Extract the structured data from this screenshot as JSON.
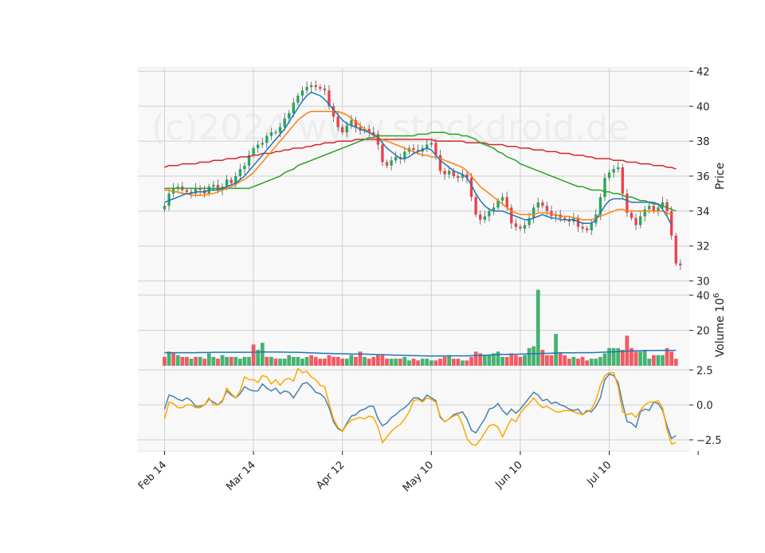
{
  "watermark": "(c)2024 www.stockdroid.de",
  "colors": {
    "background": "#f8f8f8",
    "grid": "#d0d0d0",
    "up": "#26a65b",
    "down": "#ef3f4a",
    "ma_fast": "#1f77b4",
    "ma_mid": "#ff7f0e",
    "ma_slow": "#2ca02c",
    "ma_long": "#d62728",
    "osc_a": "#4682b4",
    "osc_b": "#ffa500"
  },
  "chart_data": [
    {
      "type": "candlestick",
      "ylabel": "Price",
      "ylim": [
        29.8,
        42.2
      ],
      "yticks": [
        30,
        32,
        34,
        36,
        38,
        40,
        42
      ],
      "xlim": [
        -6,
        118
      ],
      "xticks": [
        {
          "x": 0,
          "label": "Feb 14"
        },
        {
          "x": 20,
          "label": "Mar 14"
        },
        {
          "x": 40,
          "label": "Apr 12"
        },
        {
          "x": 60,
          "label": "May 10"
        },
        {
          "x": 80,
          "label": "Jun 10"
        },
        {
          "x": 100,
          "label": "Jul 10"
        },
        {
          "x": 120,
          "label": ""
        }
      ],
      "y_axis_position": "right",
      "grid": true,
      "close": [
        34.3,
        35.0,
        35.3,
        35.4,
        35.2,
        35.1,
        35.0,
        35.3,
        35.2,
        35.0,
        35.4,
        35.5,
        35.2,
        35.4,
        35.8,
        35.6,
        36.0,
        36.4,
        36.6,
        37.2,
        37.6,
        37.8,
        37.9,
        38.3,
        38.5,
        38.5,
        38.8,
        39.3,
        39.6,
        40.2,
        40.6,
        40.9,
        41.1,
        41.2,
        41.1,
        41.0,
        40.9,
        40.0,
        39.4,
        38.8,
        38.5,
        38.9,
        39.2,
        38.8,
        38.6,
        38.7,
        38.5,
        38.4,
        37.8,
        36.8,
        36.6,
        36.9,
        37.1,
        37.0,
        37.4,
        37.6,
        37.5,
        37.4,
        37.6,
        37.8,
        37.9,
        37.2,
        36.3,
        36.1,
        36.3,
        36.0,
        35.9,
        36.1,
        35.9,
        34.8,
        33.8,
        33.5,
        33.7,
        34.0,
        34.2,
        34.6,
        34.8,
        34.2,
        33.3,
        33.1,
        33.0,
        33.2,
        33.6,
        34.2,
        34.5,
        34.3,
        34.0,
        33.7,
        33.8,
        33.6,
        33.5,
        33.4,
        33.6,
        33.1,
        33.0,
        32.9,
        33.3,
        33.8,
        34.8,
        35.9,
        36.2,
        36.4,
        36.5,
        35.0,
        33.9,
        33.6,
        33.2,
        33.7,
        34.1,
        34.3,
        34.0,
        34.2,
        34.5,
        34.0,
        32.6,
        31.0,
        30.9
      ],
      "ma_fast": [
        34.5,
        34.6,
        34.7,
        34.8,
        34.9,
        35.0,
        35.0,
        35.1,
        35.1,
        35.1,
        35.2,
        35.2,
        35.2,
        35.3,
        35.4,
        35.5,
        35.6,
        35.8,
        36.0,
        36.3,
        36.6,
        36.9,
        37.2,
        37.5,
        37.8,
        38.1,
        38.4,
        38.7,
        39.1,
        39.5,
        39.9,
        40.3,
        40.6,
        40.8,
        40.7,
        40.6,
        40.4,
        40.1,
        39.8,
        39.5,
        39.2,
        39.0,
        38.9,
        38.8,
        38.7,
        38.6,
        38.5,
        38.4,
        38.2,
        37.9,
        37.6,
        37.4,
        37.2,
        37.0,
        37.0,
        37.1,
        37.3,
        37.4,
        37.5,
        37.6,
        37.5,
        37.2,
        36.9,
        36.7,
        36.5,
        36.3,
        36.2,
        36.1,
        35.9,
        35.5,
        35.0,
        34.6,
        34.3,
        34.1,
        34.0,
        34.0,
        34.0,
        33.9,
        33.8,
        33.7,
        33.6,
        33.5,
        33.5,
        33.6,
        33.7,
        33.8,
        33.7,
        33.6,
        33.6,
        33.5,
        33.5,
        33.5,
        33.5,
        33.4,
        33.3,
        33.3,
        33.3,
        33.5,
        33.9,
        34.3,
        34.6,
        34.7,
        34.7,
        34.7,
        34.6,
        34.5,
        34.5,
        34.5,
        34.5,
        34.5,
        34.5,
        34.4,
        34.1,
        33.7,
        33.2
      ],
      "ma_mid": [
        35.2,
        35.2,
        35.1,
        35.1,
        35.0,
        35.0,
        34.9,
        34.9,
        34.9,
        34.9,
        35.0,
        35.0,
        35.1,
        35.2,
        35.3,
        35.4,
        35.5,
        35.7,
        35.8,
        36.0,
        36.2,
        36.5,
        36.8,
        37.1,
        37.4,
        37.7,
        38.0,
        38.3,
        38.6,
        38.9,
        39.2,
        39.4,
        39.6,
        39.7,
        39.7,
        39.7,
        39.7,
        39.7,
        39.7,
        39.7,
        39.6,
        39.5,
        39.3,
        39.1,
        38.9,
        38.7,
        38.5,
        38.3,
        38.2,
        38.1,
        38.0,
        37.9,
        37.8,
        37.7,
        37.6,
        37.5,
        37.4,
        37.3,
        37.2,
        37.2,
        37.1,
        37.1,
        37.0,
        36.9,
        36.8,
        36.7,
        36.6,
        36.5,
        36.3,
        36.0,
        35.7,
        35.4,
        35.2,
        35.0,
        34.8,
        34.6,
        34.4,
        34.2,
        34.0,
        33.9,
        33.8,
        33.8,
        33.8,
        33.8,
        33.9,
        33.9,
        33.9,
        33.8,
        33.8,
        33.7,
        33.7,
        33.7,
        33.6,
        33.6,
        33.5,
        33.5,
        33.5,
        33.6,
        33.7,
        33.8,
        33.9,
        34.0,
        34.1,
        34.1,
        34.0,
        34.0,
        34.0,
        34.0,
        34.0,
        34.0,
        34.0,
        34.0,
        34.0,
        33.9,
        33.8
      ],
      "ma_slow": [
        35.3,
        35.3,
        35.3,
        35.3,
        35.3,
        35.3,
        35.3,
        35.3,
        35.3,
        35.3,
        35.3,
        35.3,
        35.3,
        35.3,
        35.3,
        35.3,
        35.3,
        35.3,
        35.3,
        35.3,
        35.4,
        35.5,
        35.6,
        35.7,
        35.8,
        35.9,
        36.0,
        36.2,
        36.3,
        36.4,
        36.6,
        36.7,
        36.8,
        36.9,
        37.0,
        37.1,
        37.2,
        37.3,
        37.4,
        37.5,
        37.6,
        37.7,
        37.8,
        37.9,
        38.0,
        38.1,
        38.2,
        38.2,
        38.3,
        38.3,
        38.3,
        38.3,
        38.3,
        38.3,
        38.3,
        38.3,
        38.3,
        38.4,
        38.4,
        38.4,
        38.5,
        38.5,
        38.5,
        38.5,
        38.4,
        38.4,
        38.4,
        38.3,
        38.3,
        38.2,
        38.1,
        37.9,
        37.8,
        37.7,
        37.6,
        37.4,
        37.3,
        37.1,
        37.0,
        36.9,
        36.7,
        36.6,
        36.5,
        36.4,
        36.3,
        36.2,
        36.1,
        36.0,
        35.9,
        35.8,
        35.7,
        35.6,
        35.5,
        35.4,
        35.4,
        35.3,
        35.2,
        35.2,
        35.2,
        35.1,
        35.1,
        35.0,
        35.0,
        34.9,
        34.8,
        34.8,
        34.7,
        34.6,
        34.6,
        34.5,
        34.4,
        34.4,
        34.3,
        34.2,
        34.1,
        34.0
      ],
      "ma_long": [
        36.5,
        36.6,
        36.6,
        36.6,
        36.7,
        36.7,
        36.7,
        36.7,
        36.8,
        36.8,
        36.8,
        36.9,
        36.9,
        36.9,
        37.0,
        37.0,
        37.0,
        37.1,
        37.1,
        37.1,
        37.2,
        37.2,
        37.3,
        37.3,
        37.3,
        37.4,
        37.4,
        37.5,
        37.5,
        37.6,
        37.6,
        37.6,
        37.7,
        37.7,
        37.8,
        37.8,
        37.9,
        37.9,
        37.9,
        38.0,
        38.0,
        38.0,
        38.0,
        38.1,
        38.1,
        38.1,
        38.1,
        38.1,
        38.1,
        38.1,
        38.1,
        38.1,
        38.1,
        38.1,
        38.1,
        38.1,
        38.1,
        38.1,
        38.1,
        38.1,
        38.1,
        38.0,
        38.0,
        38.0,
        38.0,
        38.0,
        38.0,
        38.0,
        37.9,
        37.9,
        37.9,
        37.9,
        37.9,
        37.8,
        37.8,
        37.8,
        37.8,
        37.7,
        37.7,
        37.7,
        37.6,
        37.6,
        37.6,
        37.5,
        37.5,
        37.5,
        37.4,
        37.4,
        37.4,
        37.3,
        37.3,
        37.3,
        37.2,
        37.2,
        37.2,
        37.1,
        37.1,
        37.0,
        37.0,
        37.0,
        37.0,
        36.9,
        36.9,
        36.9,
        36.8,
        36.8,
        36.8,
        36.7,
        36.7,
        36.7,
        36.6,
        36.6,
        36.6,
        36.5,
        36.5,
        36.4
      ]
    },
    {
      "type": "bar",
      "ylabel": "Volume $10^6$",
      "ylim": [
        0,
        46
      ],
      "yticks": [
        20,
        40
      ],
      "grid": true,
      "volume": [
        5,
        8,
        7,
        6,
        5,
        5,
        4,
        5,
        5,
        4,
        7,
        5,
        4,
        6,
        5,
        5,
        5,
        4,
        5,
        5,
        12,
        9,
        13,
        5,
        5,
        4,
        4,
        4,
        6,
        5,
        5,
        4,
        5,
        6,
        5,
        4,
        4,
        6,
        5,
        5,
        4,
        4,
        6,
        5,
        8,
        5,
        4,
        5,
        6,
        6,
        4,
        4,
        4,
        4,
        5,
        3,
        4,
        3,
        4,
        4,
        3,
        3,
        4,
        5,
        6,
        4,
        4,
        3,
        3,
        5,
        8,
        7,
        6,
        6,
        7,
        8,
        5,
        5,
        7,
        6,
        5,
        6,
        10,
        11,
        43,
        9,
        6,
        6,
        18,
        7,
        6,
        4,
        5,
        4,
        5,
        3,
        4,
        4,
        5,
        7,
        10,
        10,
        10,
        9,
        17,
        10,
        8,
        8,
        9,
        4,
        6,
        6,
        6,
        10,
        8,
        4
      ],
      "volume_up": [
        false,
        true,
        false,
        true,
        false,
        false,
        true,
        false,
        true,
        false,
        true,
        true,
        false,
        true,
        true,
        false,
        true,
        true,
        true,
        true,
        false,
        true,
        true,
        false,
        true,
        false,
        true,
        true,
        true,
        true,
        true,
        true,
        true,
        false,
        false,
        false,
        false,
        false,
        false,
        false,
        false,
        true,
        true,
        false,
        false,
        true,
        false,
        false,
        false,
        false,
        false,
        true,
        true,
        false,
        true,
        true,
        false,
        false,
        true,
        true,
        true,
        false,
        false,
        false,
        true,
        false,
        false,
        true,
        false,
        false,
        false,
        false,
        true,
        true,
        true,
        true,
        true,
        false,
        false,
        false,
        false,
        true,
        true,
        true,
        true,
        false,
        false,
        false,
        true,
        false,
        false,
        false,
        true,
        false,
        false,
        false,
        true,
        true,
        true,
        true,
        true,
        true,
        true,
        false,
        false,
        false,
        false,
        true,
        true,
        true,
        false,
        true,
        true,
        false,
        false,
        false,
        true
      ],
      "volume_ma": [
        7.4,
        7.4,
        7.4,
        7.4,
        7.4,
        7.4,
        7.4,
        7.4,
        7.5,
        7.5,
        7.5,
        7.6,
        7.6,
        7.6,
        7.6,
        7.6,
        7.6,
        7.6,
        7.6,
        7.6,
        7.6,
        7.7,
        7.8,
        7.8,
        7.8,
        7.8,
        7.7,
        7.7,
        7.6,
        7.6,
        7.6,
        7.5,
        7.4,
        7.3,
        7.2,
        7.1,
        7.0,
        7.0,
        6.9,
        6.8,
        6.8,
        6.7,
        6.6,
        6.6,
        6.6,
        6.6,
        6.5,
        6.4,
        6.3,
        6.3,
        6.2,
        6.1,
        6.0,
        6.0,
        5.9,
        5.8,
        5.7,
        5.7,
        5.6,
        5.6,
        5.5,
        5.5,
        5.5,
        5.5,
        5.6,
        5.6,
        5.6,
        5.6,
        5.6,
        5.7,
        5.8,
        5.9,
        6.0,
        6.1,
        6.2,
        6.3,
        6.4,
        6.4,
        6.5,
        6.5,
        6.6,
        6.6,
        6.7,
        6.8,
        6.9,
        7.0,
        7.0,
        7.1,
        7.2,
        7.3,
        7.3,
        7.3,
        7.3,
        7.4,
        7.4,
        7.4,
        7.4,
        7.5,
        7.6,
        7.7,
        7.8,
        7.9,
        8.0,
        8.1,
        8.3,
        8.4,
        8.5,
        8.5,
        8.6,
        8.6,
        8.6,
        8.7,
        8.7,
        8.7,
        8.7,
        8.7
      ]
    },
    {
      "type": "line",
      "ylim": [
        -3.3,
        2.8
      ],
      "yticks": [
        {
          "v": -2.5,
          "label": "−2.5"
        },
        {
          "v": 0,
          "label": "0.0"
        },
        {
          "v": 2.5,
          "label": "2.5"
        }
      ],
      "grid": true,
      "series": [
        {
          "values": [
            -0.3,
            0.7,
            0.6,
            0.4,
            0.3,
            0.5,
            0.3,
            -0.1,
            -0.1,
            0.0,
            0.4,
            0.2,
            0.0,
            0.3,
            1.0,
            0.7,
            0.5,
            0.8,
            1.3,
            1.1,
            1.0,
            1.0,
            1.5,
            1.2,
            1.0,
            1.2,
            0.8,
            1.0,
            0.9,
            0.5,
            1.0,
            1.5,
            1.6,
            1.3,
            0.9,
            0.8,
            0.5,
            -0.2,
            -1.2,
            -1.7,
            -1.9,
            -1.3,
            -0.8,
            -0.7,
            -0.4,
            -0.3,
            -0.1,
            -0.1,
            -1.0,
            -1.5,
            -1.3,
            -0.9,
            -0.7,
            -0.4,
            -0.2,
            0.1,
            0.5,
            0.5,
            0.3,
            0.7,
            0.5,
            0.3,
            -0.9,
            -1.2,
            -1.0,
            -0.7,
            -0.6,
            -0.5,
            -1.0,
            -1.8,
            -2.0,
            -1.5,
            -1.0,
            -0.3,
            -0.2,
            0.1,
            -0.4,
            -0.7,
            -0.3,
            -0.6,
            -0.3,
            0.1,
            0.5,
            0.9,
            0.7,
            0.3,
            0.4,
            0.1,
            0.2,
            0.0,
            -0.1,
            -0.3,
            -0.4,
            -0.3,
            -0.7,
            -0.4,
            -0.5,
            -0.1,
            0.5,
            1.8,
            2.2,
            2.1,
            1.6,
            0.1,
            -1.2,
            -1.3,
            -1.6,
            -0.5,
            -0.3,
            -0.4,
            0.2,
            0.1,
            -0.4,
            -1.5,
            -2.4,
            -2.2
          ]
        },
        {
          "values": [
            -1.0,
            0.2,
            0.1,
            -0.2,
            -0.2,
            0.0,
            0.0,
            -0.2,
            -0.2,
            0.0,
            0.5,
            0.0,
            0.0,
            0.2,
            1.2,
            0.8,
            0.5,
            1.0,
            2.0,
            1.8,
            1.8,
            1.6,
            2.1,
            2.0,
            1.5,
            1.8,
            1.4,
            1.8,
            1.9,
            1.7,
            2.6,
            2.3,
            2.4,
            2.0,
            1.8,
            1.4,
            1.3,
            0.1,
            -1.0,
            -1.6,
            -1.9,
            -1.4,
            -1.1,
            -1.0,
            -0.9,
            -1.0,
            -0.8,
            -0.9,
            -1.6,
            -2.7,
            -2.3,
            -1.9,
            -1.6,
            -1.4,
            -1.0,
            -0.5,
            0.3,
            0.4,
            0.2,
            0.5,
            0.4,
            0.2,
            -0.8,
            -1.2,
            -1.0,
            -0.8,
            -0.7,
            -1.4,
            -2.4,
            -2.8,
            -2.9,
            -2.5,
            -2.0,
            -1.5,
            -1.4,
            -1.6,
            -2.3,
            -1.6,
            -1.0,
            -1.2,
            -0.6,
            -0.2,
            0.1,
            0.5,
            0.1,
            -0.2,
            -0.1,
            -0.3,
            -0.5,
            -0.5,
            -0.4,
            -0.4,
            -0.5,
            -0.6,
            -0.7,
            -0.5,
            -0.3,
            0.3,
            1.4,
            2.1,
            2.3,
            2.3,
            1.3,
            -0.5,
            -0.7,
            -0.6,
            -0.9,
            -0.4,
            0.0,
            0.2,
            0.2,
            0.3,
            -0.2,
            -1.8,
            -2.8,
            -2.7
          ]
        }
      ]
    }
  ]
}
